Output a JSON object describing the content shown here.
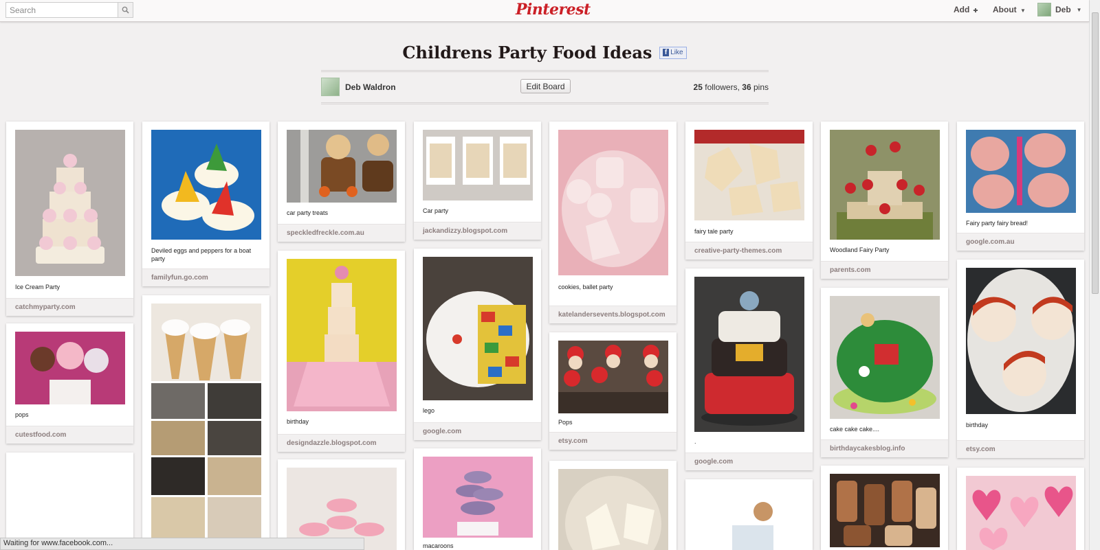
{
  "search": {
    "placeholder": "Search"
  },
  "logo": "Pinterest",
  "nav": {
    "add": "Add",
    "about": "About",
    "user": "Deb"
  },
  "board": {
    "title": "Childrens Party Food Ideas",
    "like_label": "Like",
    "owner": "Deb Waldron",
    "edit_label": "Edit Board",
    "followers": "25",
    "followers_label": "followers,",
    "pins": "36",
    "pins_label": "pins"
  },
  "pins": [
    {
      "desc": "Ice Cream Party",
      "source": "catchmyparty.com"
    },
    {
      "desc": "pops",
      "source": "cutestfood.com"
    },
    {
      "desc": "Deviled eggs and peppers for a boat party",
      "source": "familyfun.go.com"
    },
    {
      "desc": "car party treats",
      "source": "speckledfreckle.com.au"
    },
    {
      "desc": "birthday",
      "source": "designdazzle.blogspot.com"
    },
    {
      "desc": "Car party",
      "source": "jackandizzy.blogspot.com"
    },
    {
      "desc": "lego",
      "source": "google.com"
    },
    {
      "desc": "macaroons",
      "source": ""
    },
    {
      "desc": "cookies, ballet party",
      "source": "katelandersevents.blogspot.com"
    },
    {
      "desc": "Pops",
      "source": "etsy.com"
    },
    {
      "desc": "fairy tale party",
      "source": "creative-party-themes.com"
    },
    {
      "desc": ".",
      "source": "google.com"
    },
    {
      "desc": "Woodland Fairy Party",
      "source": "parents.com"
    },
    {
      "desc": "cake cake cake....",
      "source": "birthdaycakesblog.info"
    },
    {
      "desc": "Fairy party fairy bread!",
      "source": "google.com.au"
    },
    {
      "desc": "birthday",
      "source": "etsy.com"
    }
  ],
  "status_text": "Waiting for www.facebook.com...",
  "colors": {
    "brand": "#cb2027",
    "background": "#f2f0f0",
    "source_text": "#8c7e7e"
  }
}
